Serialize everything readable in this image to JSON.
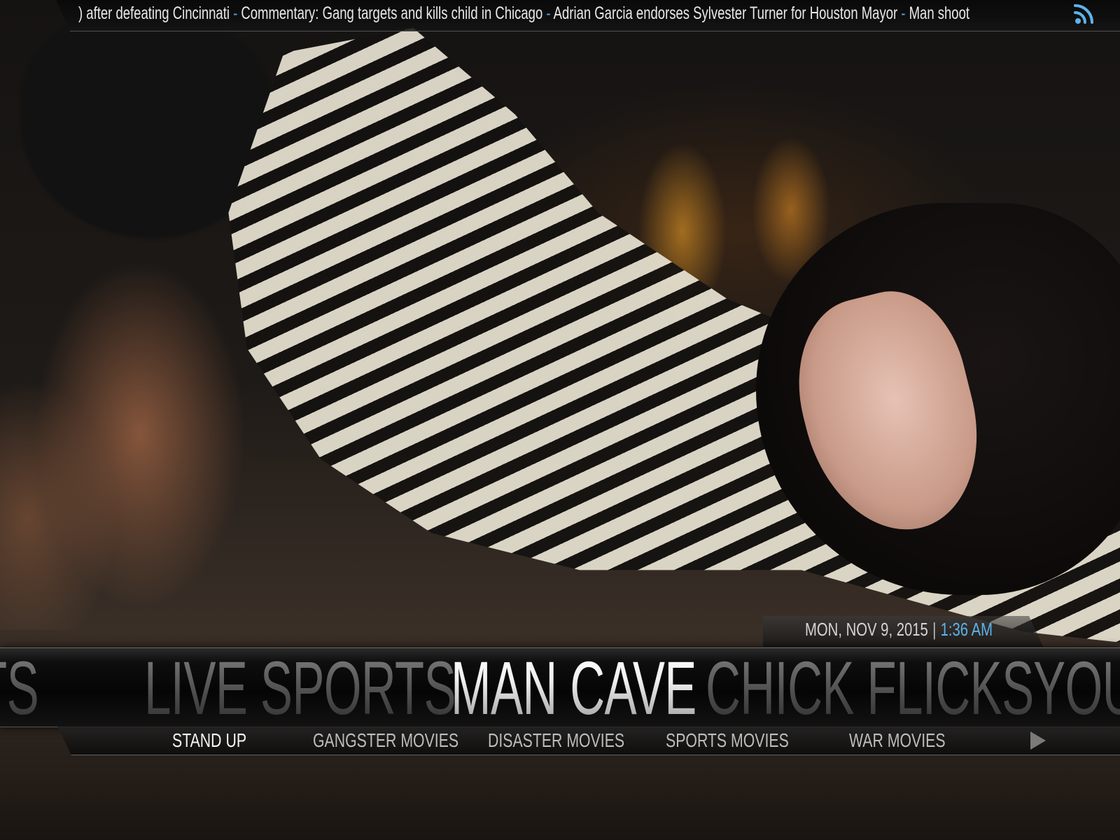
{
  "ticker": {
    "segments": [
      ") after defeating Cincinnati",
      "Commentary: Gang targets and kills child in Chicago",
      "Adrian Garcia endorses Sylvester Turner for Houston Mayor",
      "Man shoot"
    ],
    "separator": " - ",
    "icon": "rss-feed-icon"
  },
  "datetime": {
    "date": "MON, NOV 9, 2015",
    "separator": "|",
    "time": "1:36 AM"
  },
  "main_menu": {
    "items": [
      {
        "label": "TS",
        "state": "partial"
      },
      {
        "label": "LIVE SPORTS",
        "state": "dim"
      },
      {
        "label": "MAN CAVE",
        "state": "active"
      },
      {
        "label": "CHICK FLICKS",
        "state": "dim"
      },
      {
        "label": "YOU",
        "state": "partial"
      }
    ]
  },
  "sub_menu": {
    "items": [
      {
        "label": "STAND UP",
        "selected": true
      },
      {
        "label": "GANGSTER MOVIES",
        "selected": false
      },
      {
        "label": "DISASTER MOVIES",
        "selected": false
      },
      {
        "label": "SPORTS MOVIES",
        "selected": false
      },
      {
        "label": "WAR MOVIES",
        "selected": false
      }
    ],
    "next_icon": "play-right-arrow-icon"
  },
  "colors": {
    "accent": "#5db3ec",
    "ticker_separator": "#4aa8e0",
    "text": "#e9e9e9",
    "menu_dim": "#8a8a8a"
  }
}
